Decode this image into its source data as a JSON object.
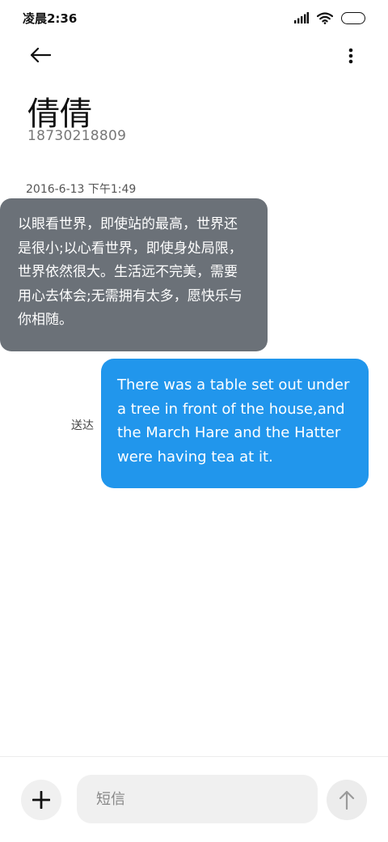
{
  "status_bar": {
    "time": "凌晨2:36",
    "icons": [
      "signal-icon",
      "wifi-icon",
      "battery-icon"
    ]
  },
  "header": {
    "back_icon": "arrow-left-icon",
    "more_icon": "more-vertical-icon"
  },
  "contact": {
    "name": "倩倩",
    "number": "18730218809"
  },
  "conversation": {
    "timestamp": "2016-6-13 下午1:49",
    "incoming_message": "以眼看世界，即使站的最高，世界还是很小;以心看世界，即使身处局限，世界依然很大。生活远不完美，需要用心去体会;无需拥有太多，愿快乐与你相随。",
    "outgoing_message": "There was a table set out under a tree in front of the house,and the March Hare and the Hatter were having tea at it.",
    "sent_status": "送达"
  },
  "composer": {
    "placeholder": "短信",
    "add_icon": "plus-icon",
    "send_icon": "arrow-up-icon"
  },
  "colors": {
    "incoming_bubble": "#6b7178",
    "outgoing_bubble": "#2196ec",
    "composer_bg": "#f0f0f0"
  }
}
